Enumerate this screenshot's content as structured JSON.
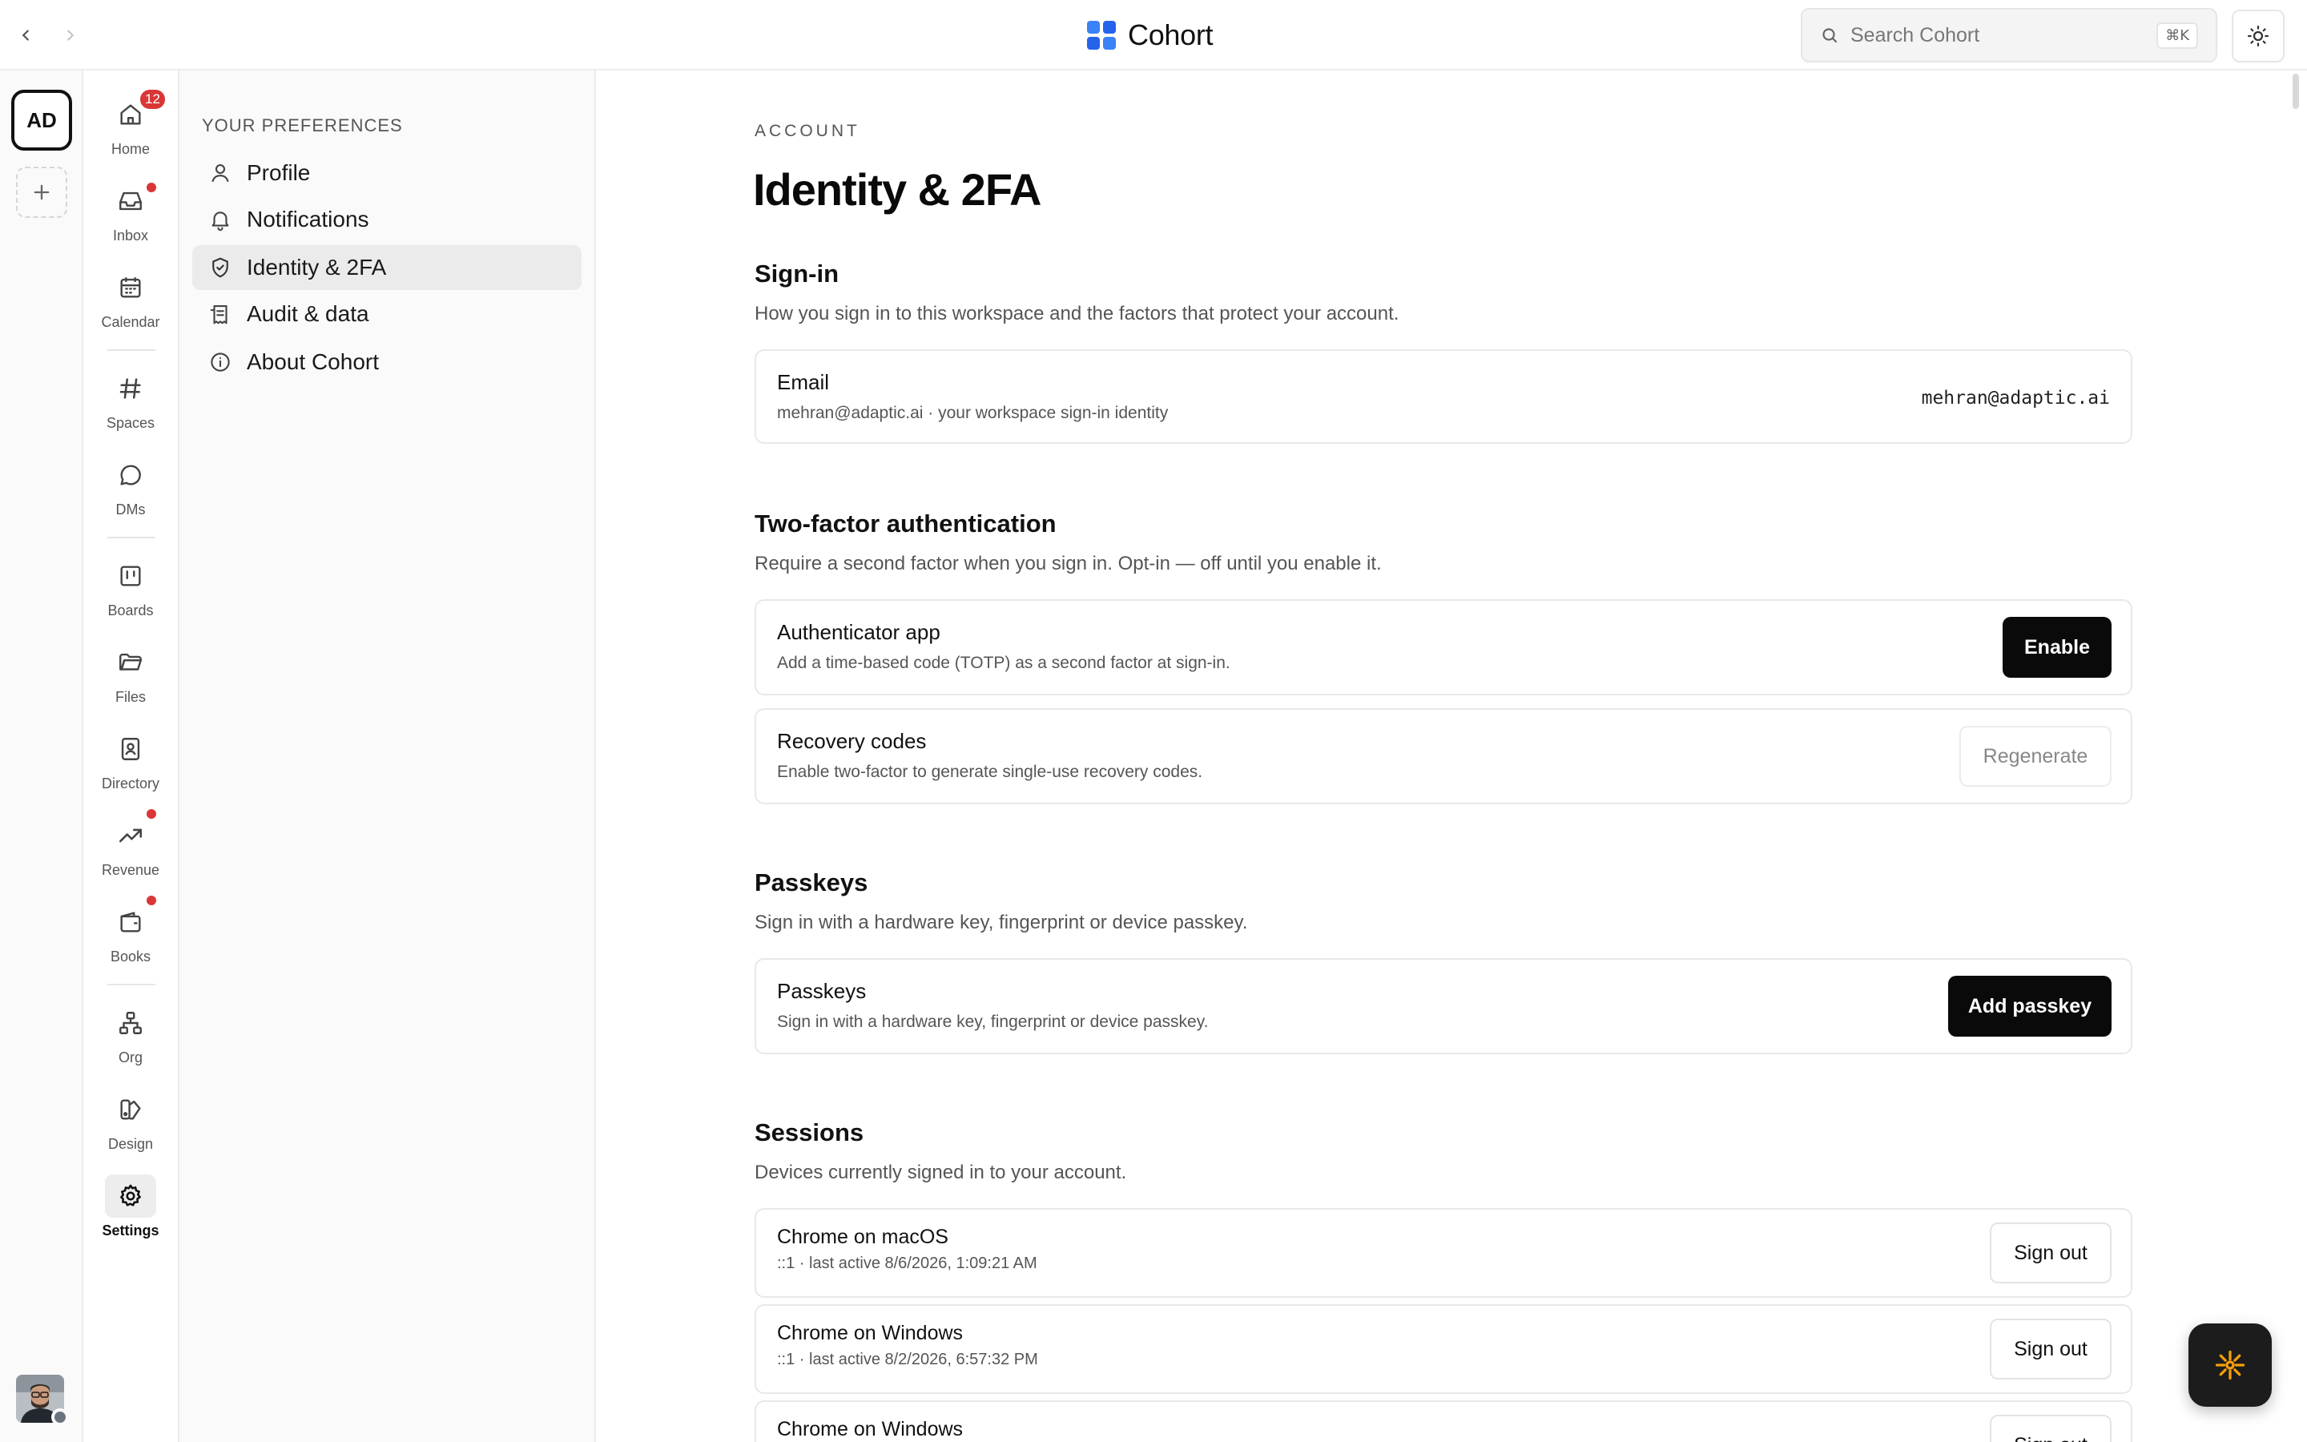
{
  "app": {
    "name": "Cohort",
    "brand_colors": [
      "#2563eb",
      "#3b82f6"
    ]
  },
  "search": {
    "placeholder": "Search Cohort",
    "shortcut": "⌘K"
  },
  "workspace": {
    "initials": "AD"
  },
  "rail": {
    "items": [
      {
        "label": "Home",
        "icon": "home-icon",
        "badge": "12"
      },
      {
        "label": "Inbox",
        "icon": "inbox-icon",
        "dot": true
      },
      {
        "label": "Calendar",
        "icon": "calendar-icon"
      },
      {
        "label": "Spaces",
        "icon": "hash-icon"
      },
      {
        "label": "DMs",
        "icon": "message-icon"
      },
      {
        "label": "Boards",
        "icon": "board-icon"
      },
      {
        "label": "Files",
        "icon": "folder-icon"
      },
      {
        "label": "Directory",
        "icon": "contact-book-icon",
        "dot": true
      },
      {
        "label": "Revenue",
        "icon": "trending-up-icon",
        "dot": true
      },
      {
        "label": "Books",
        "icon": "wallet-icon"
      },
      {
        "label": "Org",
        "icon": "org-chart-icon"
      },
      {
        "label": "Design",
        "icon": "palette-icon"
      },
      {
        "label": "Settings",
        "icon": "gear-icon",
        "active": true
      }
    ],
    "badge_color": "#d93636"
  },
  "prefs": {
    "title": "YOUR PREFERENCES",
    "items": [
      {
        "label": "Profile",
        "icon": "user-icon"
      },
      {
        "label": "Notifications",
        "icon": "bell-icon"
      },
      {
        "label": "Identity & 2FA",
        "icon": "shield-check-icon",
        "active": true
      },
      {
        "label": "Audit & data",
        "icon": "receipt-icon"
      },
      {
        "label": "About Cohort",
        "icon": "info-icon"
      }
    ]
  },
  "page": {
    "eyebrow": "ACCOUNT",
    "title": "Identity & 2FA"
  },
  "signin": {
    "title": "Sign-in",
    "desc": "How you sign in to this workspace and the factors that protect your account.",
    "email": {
      "label": "Email",
      "sub": "mehran@adaptic.ai · your workspace sign-in identity",
      "value": "mehran@adaptic.ai"
    }
  },
  "twofa": {
    "title": "Two-factor authentication",
    "desc": "Require a second factor when you sign in. Opt-in — off until you enable it.",
    "authenticator": {
      "label": "Authenticator app",
      "sub": "Add a time-based code (TOTP) as a second factor at sign-in.",
      "button": "Enable"
    },
    "recovery": {
      "label": "Recovery codes",
      "sub": "Enable two-factor to generate single-use recovery codes.",
      "button": "Regenerate"
    }
  },
  "passkeys": {
    "title": "Passkeys",
    "desc": "Sign in with a hardware key, fingerprint or device passkey.",
    "card": {
      "label": "Passkeys",
      "sub": "Sign in with a hardware key, fingerprint or device passkey.",
      "button": "Add passkey"
    }
  },
  "sessions": {
    "title": "Sessions",
    "desc": "Devices currently signed in to your account.",
    "items": [
      {
        "device": "Chrome on macOS",
        "detail": "::1 · last active 8/6/2026, 1:09:21 AM",
        "button": "Sign out"
      },
      {
        "device": "Chrome on Windows",
        "detail": "::1 · last active 8/2/2026, 6:57:32 PM",
        "button": "Sign out"
      },
      {
        "device": "Chrome on Windows",
        "detail": "",
        "button": "Sign out"
      }
    ]
  },
  "assistant": {
    "icon": "sparkle-icon",
    "accent": "#f59e0b"
  }
}
